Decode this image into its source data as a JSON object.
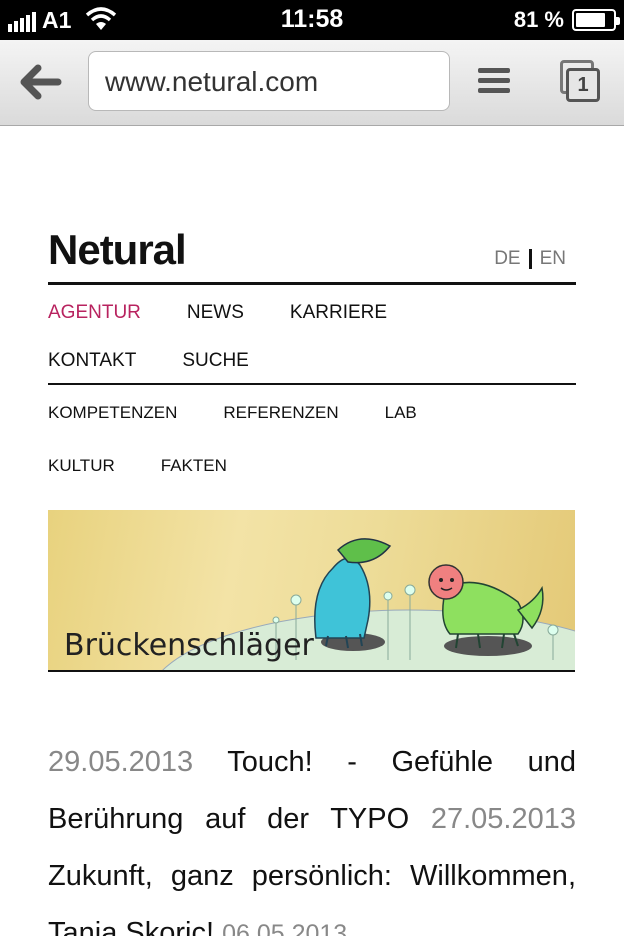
{
  "status_bar": {
    "carrier": "A1",
    "time": "11:58",
    "battery_percent": "81 %"
  },
  "browser": {
    "url": "www.netural.com",
    "tab_count": "1"
  },
  "site": {
    "logo": "Netural",
    "languages": [
      "DE",
      "EN"
    ],
    "primary_nav": [
      {
        "label": "AGENTUR",
        "active": true
      },
      {
        "label": "NEWS",
        "active": false
      },
      {
        "label": "KARRIERE",
        "active": false
      },
      {
        "label": "KONTAKT",
        "active": false
      },
      {
        "label": "SUCHE",
        "active": false
      }
    ],
    "sub_nav": [
      "KOMPETENZEN",
      "REFERENZEN",
      "LAB",
      "KULTUR",
      "FAKTEN"
    ],
    "banner_title": "Brückenschläger",
    "news": [
      {
        "date": "29.05.2013",
        "title": "Touch! - Gefühle und Berührung auf der TYPO"
      },
      {
        "date": "27.05.2013",
        "title": "Zukunft, ganz persönlich: Willkommen, Tanja Skoric!"
      },
      {
        "date": "06.05.2013",
        "title": ""
      }
    ]
  },
  "colors": {
    "active_nav": "#b8235f",
    "date_text": "#888888"
  }
}
